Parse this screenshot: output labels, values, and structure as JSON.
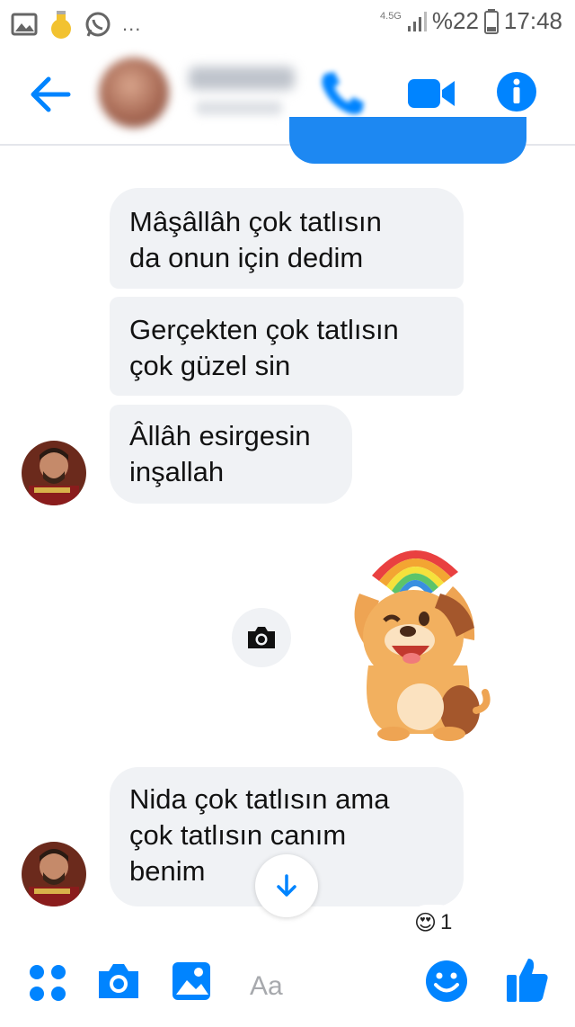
{
  "status_bar": {
    "network": "4.5G",
    "battery": "%22",
    "time": "17:48",
    "more": "..."
  },
  "header": {
    "contact_name": "",
    "icons": {
      "back": "arrow-left-icon",
      "call": "phone-icon",
      "video": "video-camera-icon",
      "info": "info-icon"
    },
    "accent_color": "#0084ff"
  },
  "messages": [
    {
      "sender": "contact",
      "text_line1": "Mâşâllâh çok tatlısın",
      "text_line2": "da onun için dedim"
    },
    {
      "sender": "contact",
      "text_line1": "Gerçekten çok tatlısın",
      "text_line2": "çok güzel sin"
    },
    {
      "sender": "contact",
      "text_line1": "Âllâh esirgesin",
      "text_line2": "inşallah"
    },
    {
      "sender": "contact",
      "text_line1": "Nida çok tatlısın ama",
      "text_line2": "çok tatlısın canım",
      "text_line3": "benim"
    }
  ],
  "sticker": {
    "description_icon": "puppy-rainbow-sticker"
  },
  "reaction": {
    "emoji": "😍",
    "count": "1"
  },
  "composer": {
    "placeholder": "Aa",
    "icons": {
      "more": "four-dots-icon",
      "camera": "camera-icon",
      "gallery": "image-icon",
      "emoji": "smiley-icon",
      "like": "thumbs-up-icon"
    }
  },
  "colors": {
    "bubble_gray": "#f0f2f5",
    "brand_blue": "#0084ff"
  }
}
